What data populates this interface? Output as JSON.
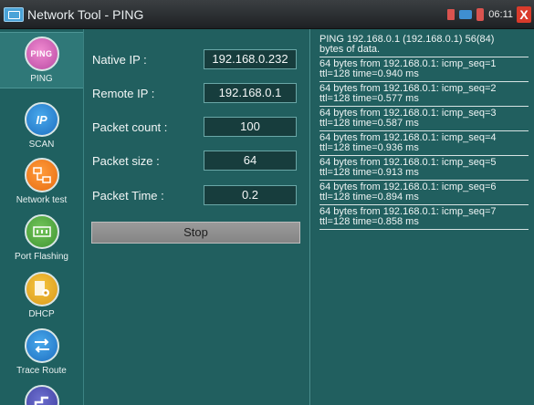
{
  "window": {
    "title": "Network Tool - PING"
  },
  "status_bar": {
    "clock": "06:11",
    "close_glyph": "X"
  },
  "sidebar": {
    "items": [
      {
        "label": "PING",
        "icon": "ping-icon",
        "icon_text": "PING",
        "active": true
      },
      {
        "label": "SCAN",
        "icon": "ip-scan-icon",
        "icon_text": "IP"
      },
      {
        "label": "Network test",
        "icon": "network-test-icon",
        "icon_text": ""
      },
      {
        "label": "Port Flashing",
        "icon": "port-flashing-icon",
        "icon_text": ""
      },
      {
        "label": "DHCP",
        "icon": "dhcp-icon",
        "icon_text": ""
      },
      {
        "label": "Trace Route",
        "icon": "trace-route-icon",
        "icon_text": ""
      },
      {
        "label": "",
        "icon": "more-tools-icon",
        "icon_text": ""
      }
    ]
  },
  "form": {
    "native_ip": {
      "label": "Native IP :",
      "value": "192.168.0.232"
    },
    "remote_ip": {
      "label": "Remote IP :",
      "value": "192.168.0.1"
    },
    "packet_count": {
      "label": "Packet count :",
      "value": "100"
    },
    "packet_size": {
      "label": "Packet size :",
      "value": "64"
    },
    "packet_time": {
      "label": "Packet Time :",
      "value": "0.2"
    },
    "stop_label": "Stop"
  },
  "log": [
    "PING 192.168.0.1 (192.168.0.1) 56(84)\nbytes of data.",
    "64 bytes from 192.168.0.1: icmp_seq=1\nttl=128 time=0.940 ms",
    "64 bytes from 192.168.0.1: icmp_seq=2\nttl=128 time=0.577 ms",
    "64 bytes from 192.168.0.1: icmp_seq=3\nttl=128 time=0.587 ms",
    "64 bytes from 192.168.0.1: icmp_seq=4\nttl=128 time=0.936 ms",
    "64 bytes from 192.168.0.1: icmp_seq=5\nttl=128 time=0.913 ms",
    "64 bytes from 192.168.0.1: icmp_seq=6\nttl=128 time=0.894 ms",
    "64 bytes from 192.168.0.1: icmp_seq=7\nttl=128 time=0.858 ms"
  ],
  "colors": {
    "background": "#1f5a5a",
    "stop_button": "#8e8e8e",
    "close": "#d93b2b"
  }
}
